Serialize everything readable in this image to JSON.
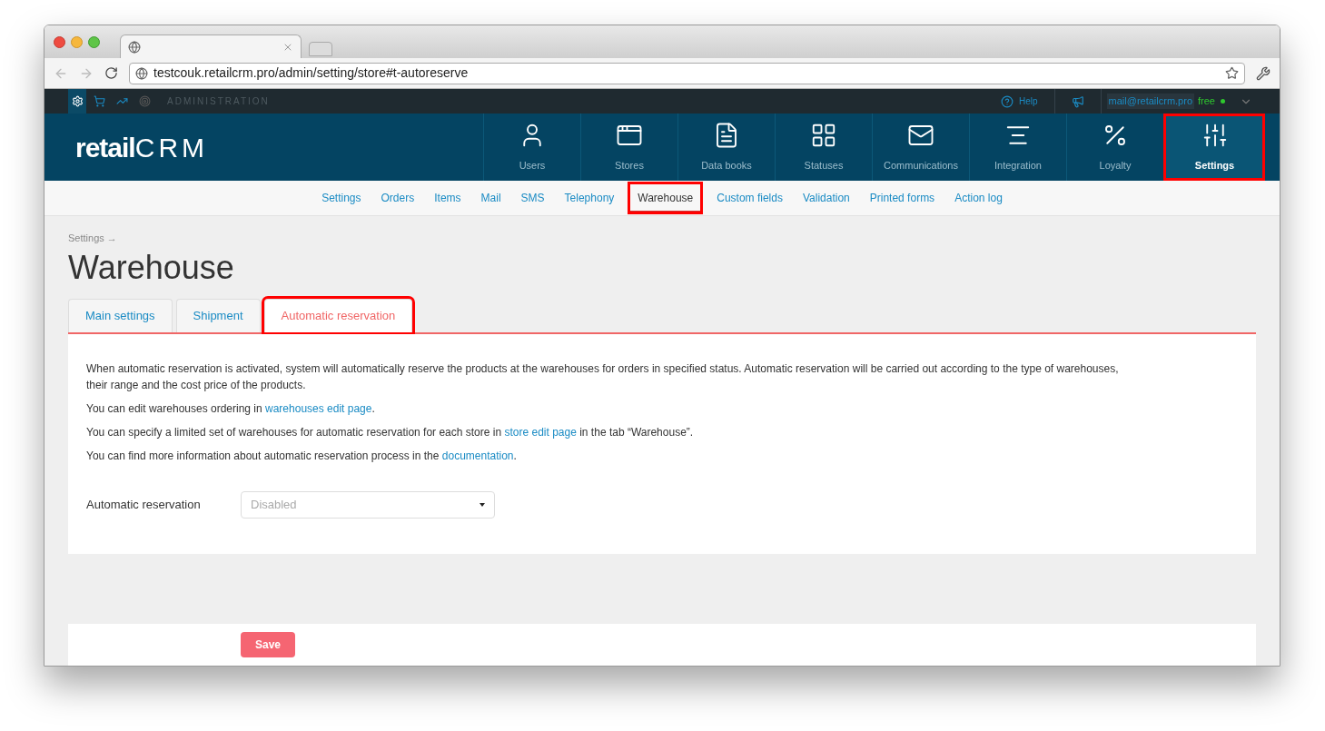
{
  "browser": {
    "url": "testcouk.retailcrm.pro/admin/setting/store#t-autoreserve"
  },
  "admin_bar": {
    "section": "ADMINISTRATION",
    "help": "Help",
    "user_email": "mail@retailcrm.pro",
    "plan": "free",
    "online": true
  },
  "logo": {
    "prefix": "retail",
    "suffix": "CRM"
  },
  "main_nav": [
    {
      "label": "Users",
      "selected": false,
      "highlighted": false
    },
    {
      "label": "Stores",
      "selected": false,
      "highlighted": false
    },
    {
      "label": "Data books",
      "selected": false,
      "highlighted": false
    },
    {
      "label": "Statuses",
      "selected": false,
      "highlighted": false
    },
    {
      "label": "Communications",
      "selected": false,
      "highlighted": false
    },
    {
      "label": "Integration",
      "selected": false,
      "highlighted": false
    },
    {
      "label": "Loyalty",
      "selected": false,
      "highlighted": false
    },
    {
      "label": "Settings",
      "selected": true,
      "highlighted": true
    }
  ],
  "sub_nav": [
    {
      "label": "Settings",
      "selected": false,
      "highlighted": false
    },
    {
      "label": "Orders",
      "selected": false,
      "highlighted": false
    },
    {
      "label": "Items",
      "selected": false,
      "highlighted": false
    },
    {
      "label": "Mail",
      "selected": false,
      "highlighted": false
    },
    {
      "label": "SMS",
      "selected": false,
      "highlighted": false
    },
    {
      "label": "Telephony",
      "selected": false,
      "highlighted": false
    },
    {
      "label": "Warehouse",
      "selected": true,
      "highlighted": true
    },
    {
      "label": "Custom fields",
      "selected": false,
      "highlighted": false
    },
    {
      "label": "Validation",
      "selected": false,
      "highlighted": false
    },
    {
      "label": "Printed forms",
      "selected": false,
      "highlighted": false
    },
    {
      "label": "Action log",
      "selected": false,
      "highlighted": false
    }
  ],
  "breadcrumb": "Settings →",
  "page_title": "Warehouse",
  "tabs": [
    {
      "label": "Main settings",
      "selected": false,
      "highlighted": false
    },
    {
      "label": "Shipment",
      "selected": false,
      "highlighted": false
    },
    {
      "label": "Automatic reservation",
      "selected": true,
      "highlighted": true
    }
  ],
  "paragraphs": [
    [
      {
        "kind": "text",
        "text": "When automatic reservation is activated, system will automatically reserve the products at the warehouses for orders in specified status. Automatic reservation will be carried out according to the type of warehouses, their range and the cost price of the products."
      }
    ],
    [
      {
        "kind": "text",
        "text": "You can edit warehouses ordering in "
      },
      {
        "kind": "link",
        "text": "warehouses edit page"
      },
      {
        "kind": "text",
        "text": "."
      }
    ],
    [
      {
        "kind": "text",
        "text": "You can specify a limited set of warehouses for automatic reservation for each store in "
      },
      {
        "kind": "link",
        "text": "store edit page"
      },
      {
        "kind": "text",
        "text": " in the tab “Warehouse”."
      }
    ],
    [
      {
        "kind": "text",
        "text": "You can find more information about automatic reservation process in the "
      },
      {
        "kind": "link",
        "text": "documentation"
      },
      {
        "kind": "text",
        "text": "."
      }
    ]
  ],
  "field": {
    "label": "Automatic reservation",
    "value": "Disabled"
  },
  "save_button": "Save"
}
